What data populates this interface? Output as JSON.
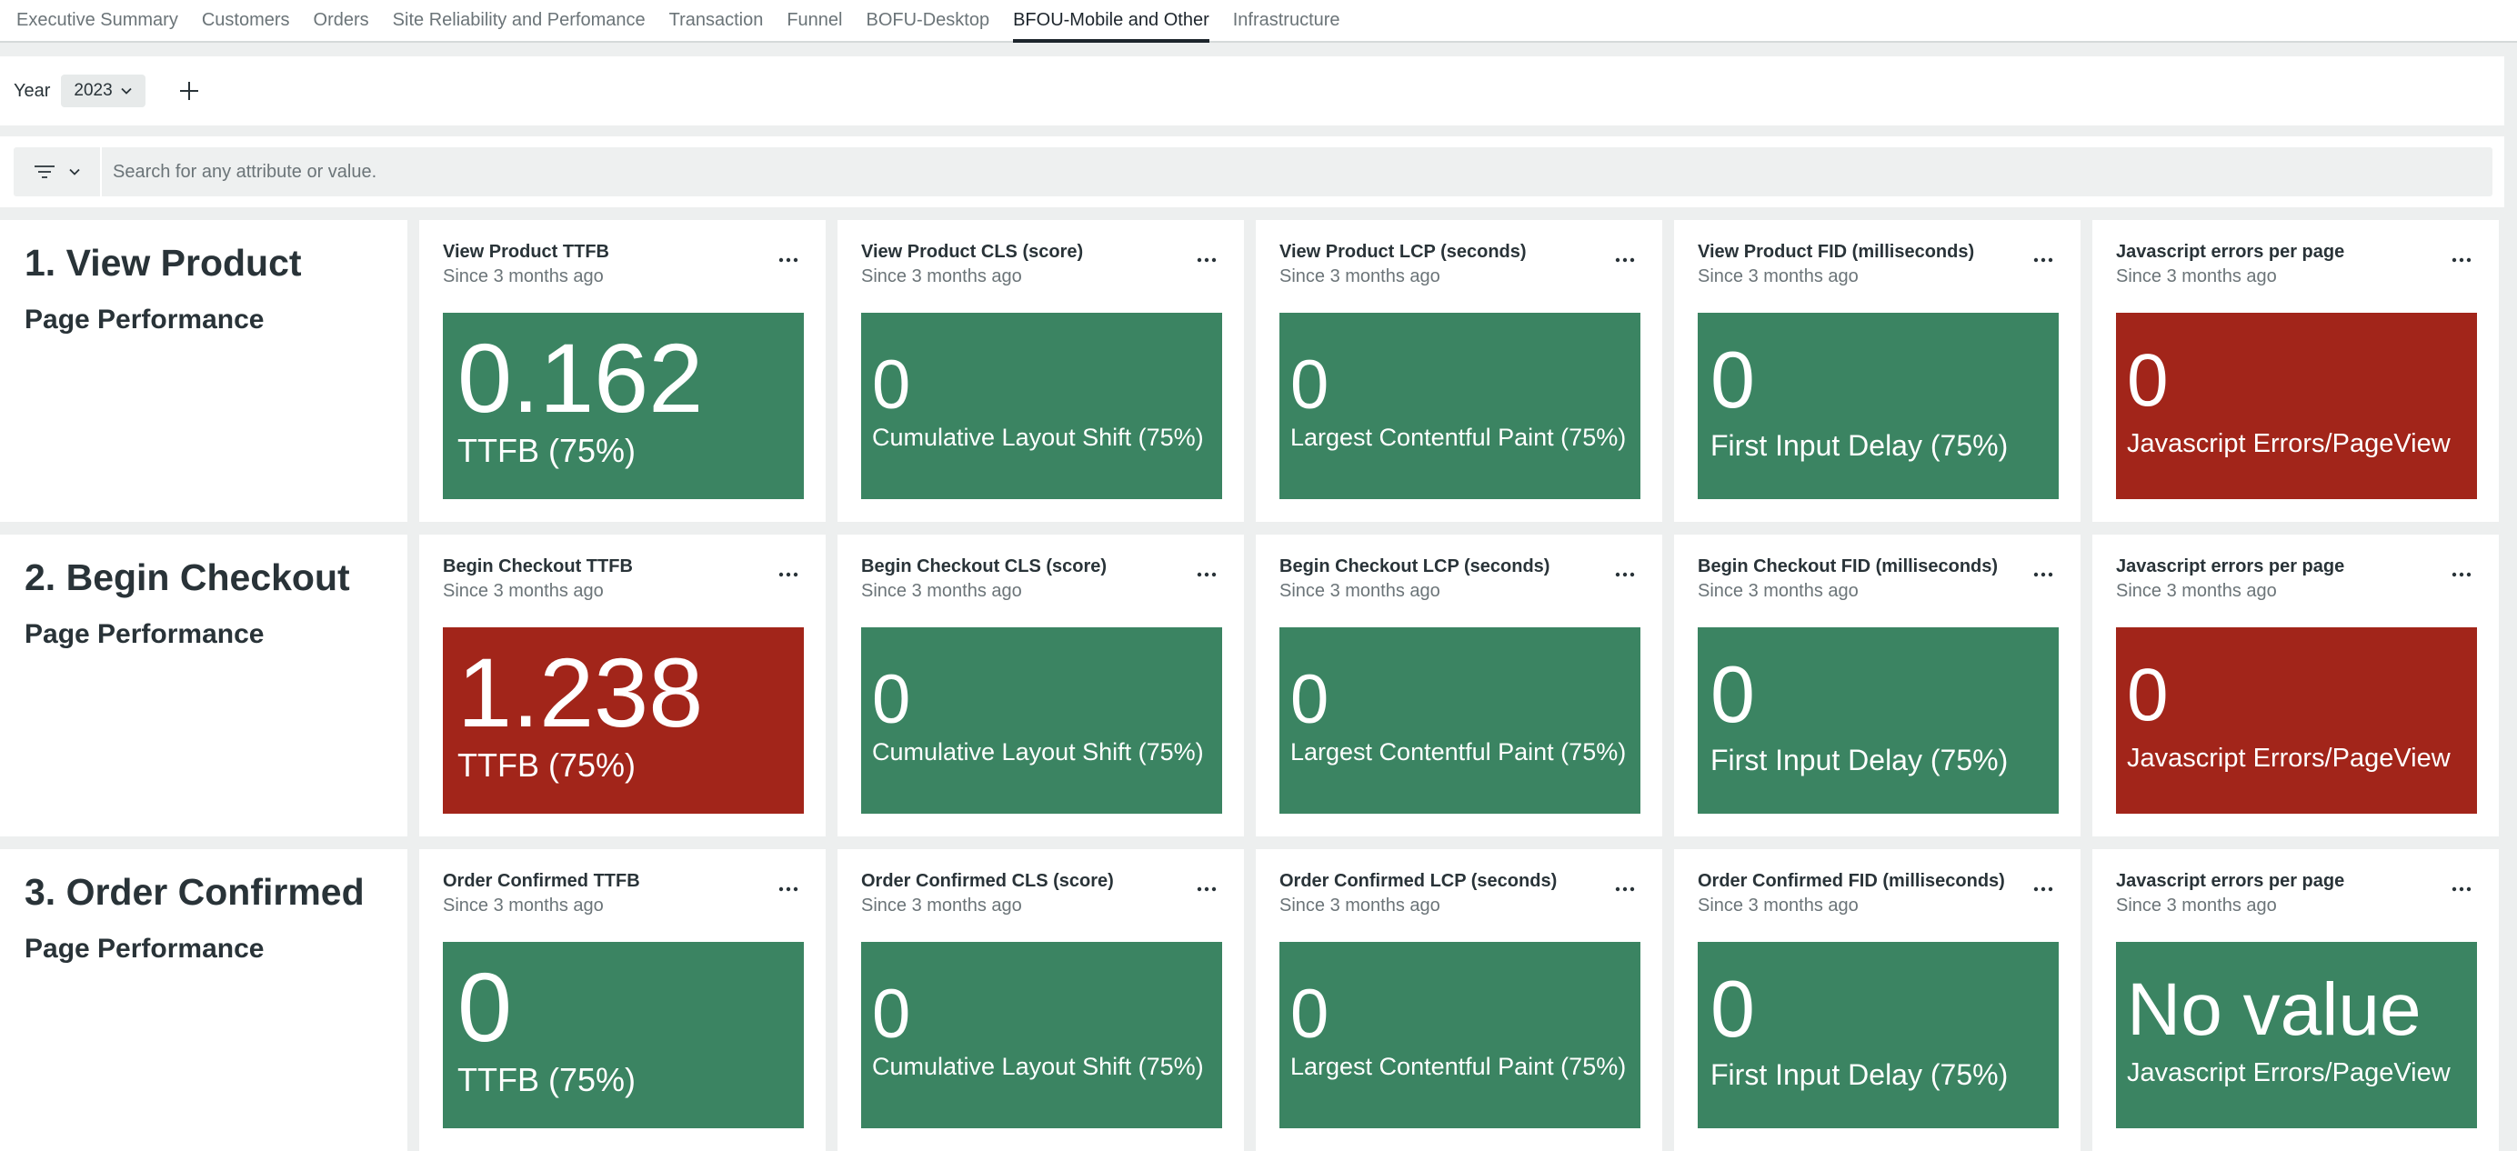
{
  "tabs": [
    {
      "label": "Executive Summary",
      "active": false
    },
    {
      "label": "Customers",
      "active": false
    },
    {
      "label": "Orders",
      "active": false
    },
    {
      "label": "Site Reliability and Perfomance",
      "active": false
    },
    {
      "label": "Transaction",
      "active": false
    },
    {
      "label": "Funnel",
      "active": false
    },
    {
      "label": "BOFU-Desktop",
      "active": false
    },
    {
      "label": "BFOU-Mobile and Other",
      "active": true
    },
    {
      "label": "Infrastructure",
      "active": false
    }
  ],
  "variables": {
    "year_label": "Year",
    "year_value": "2023"
  },
  "filter": {
    "placeholder": "Search for any attribute or value."
  },
  "colors": {
    "good": "#3b8462",
    "bad": "#a2251a"
  },
  "rows": [
    {
      "section_title": "1. View Product",
      "section_subtitle": "Page Performance",
      "widgets": [
        {
          "type": "ttfb",
          "title": "View Product TTFB",
          "since": "Since 3 months ago",
          "value": "0.162",
          "label": "TTFB (75%)",
          "status": "bad-no",
          "color": "green"
        },
        {
          "type": "cls",
          "title": "View Product CLS (score)",
          "since": "Since 3 months ago",
          "value": "0",
          "label": "Cumulative Layout Shift (75%)",
          "color": "green"
        },
        {
          "type": "lcp",
          "title": "View Product LCP (seconds)",
          "since": "Since 3 months ago",
          "value": "0",
          "label": "Largest Contentful Paint (75%)",
          "color": "green"
        },
        {
          "type": "fid",
          "title": "View Product FID (milliseconds)",
          "since": "Since 3 months ago",
          "value": "0",
          "label": "First Input Delay (75%)",
          "color": "green"
        },
        {
          "type": "js",
          "title": "Javascript errors per page",
          "since": "Since 3 months ago",
          "value": "0",
          "label": "Javascript Errors/PageView",
          "color": "red"
        }
      ]
    },
    {
      "section_title": "2. Begin Checkout",
      "section_subtitle": "Page Performance",
      "widgets": [
        {
          "type": "ttfb",
          "title": "Begin Checkout TTFB",
          "since": "Since 3 months ago",
          "value": "1.238",
          "label": "TTFB (75%)",
          "color": "red"
        },
        {
          "type": "cls",
          "title": "Begin Checkout CLS (score)",
          "since": "Since 3 months ago",
          "value": "0",
          "label": "Cumulative Layout Shift (75%)",
          "color": "green"
        },
        {
          "type": "lcp",
          "title": "Begin Checkout LCP (seconds)",
          "since": "Since 3 months ago",
          "value": "0",
          "label": "Largest Contentful Paint (75%)",
          "color": "green"
        },
        {
          "type": "fid",
          "title": "Begin Checkout FID (milliseconds)",
          "since": "Since 3 months ago",
          "value": "0",
          "label": "First Input Delay (75%)",
          "color": "green"
        },
        {
          "type": "js",
          "title": "Javascript errors per page",
          "since": "Since 3 months ago",
          "value": "0",
          "label": "Javascript Errors/PageView",
          "color": "red"
        }
      ]
    },
    {
      "section_title": "3. Order Confirmed",
      "section_subtitle": "Page Performance",
      "widgets": [
        {
          "type": "ttfb",
          "title": "Order Confirmed TTFB",
          "since": "Since 3 months ago",
          "value": "0",
          "label": "TTFB (75%)",
          "color": "green"
        },
        {
          "type": "cls",
          "title": "Order Confirmed CLS (score)",
          "since": "Since 3 months ago",
          "value": "0",
          "label": "Cumulative Layout Shift (75%)",
          "color": "green"
        },
        {
          "type": "lcp",
          "title": "Order Confirmed LCP (seconds)",
          "since": "Since 3 months ago",
          "value": "0",
          "label": "Largest Contentful Paint (75%)",
          "color": "green"
        },
        {
          "type": "fid",
          "title": "Order Confirmed FID (milliseconds)",
          "since": "Since 3 months ago",
          "value": "0",
          "label": "First Input Delay (75%)",
          "color": "green"
        },
        {
          "type": "js",
          "title": "Javascript errors per page",
          "since": "Since 3 months ago",
          "value": "No value",
          "label": "Javascript Errors/PageView",
          "color": "green"
        }
      ]
    }
  ]
}
